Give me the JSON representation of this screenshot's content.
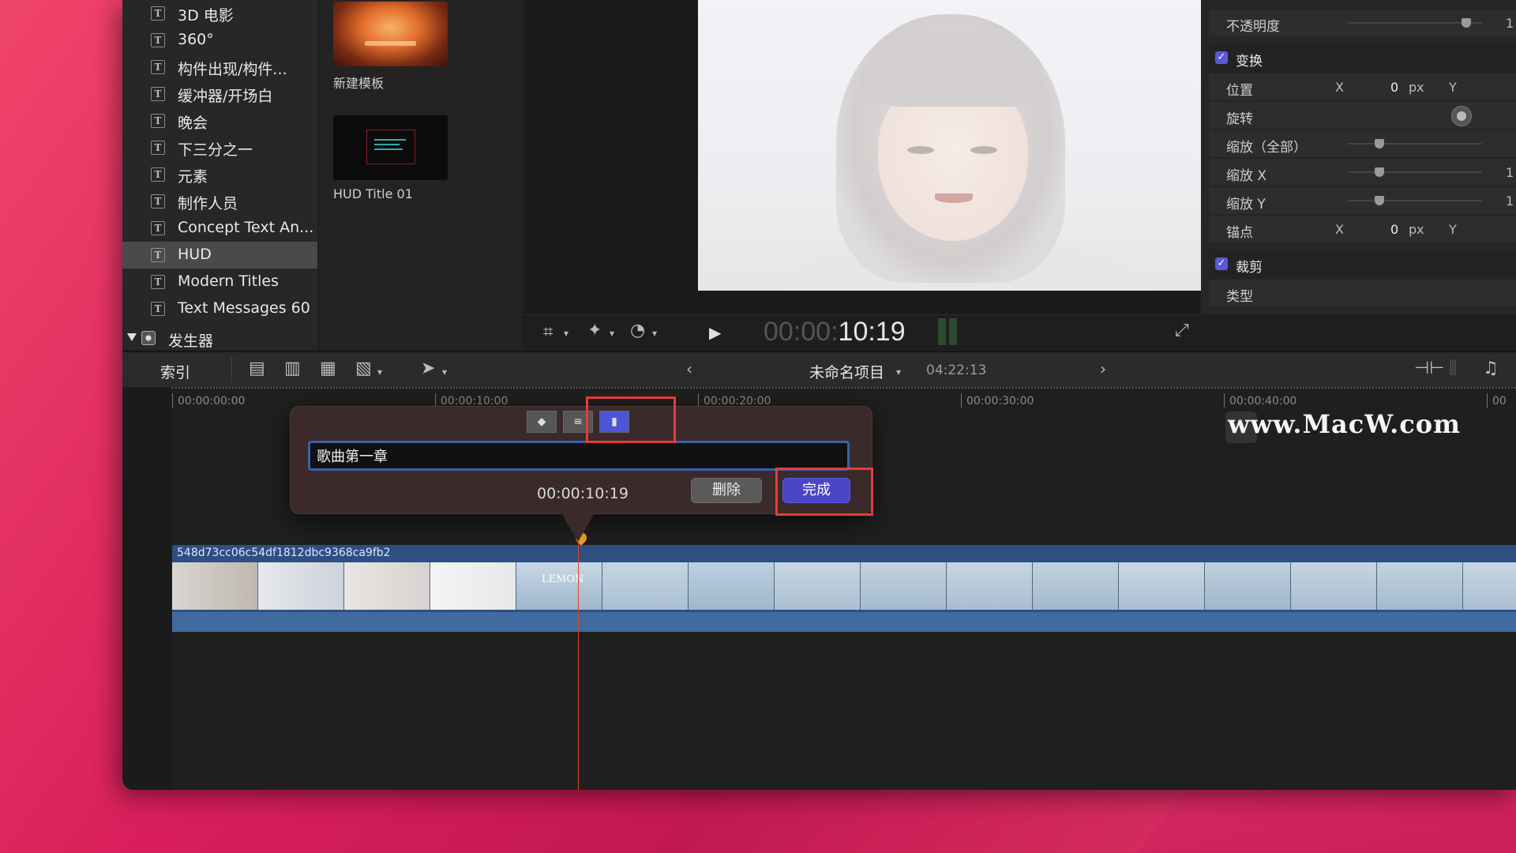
{
  "sidebar": {
    "items": [
      {
        "label": "3D 电影"
      },
      {
        "label": "360°"
      },
      {
        "label": "构件出现/构件..."
      },
      {
        "label": "缓冲器/开场白"
      },
      {
        "label": "晚会"
      },
      {
        "label": "下三分之一"
      },
      {
        "label": "元素"
      },
      {
        "label": "制作人员"
      },
      {
        "label": "Concept Text An..."
      },
      {
        "label": "HUD"
      },
      {
        "label": "Modern Titles"
      },
      {
        "label": "Text Messages 60"
      }
    ],
    "selected_index": 9,
    "group": {
      "label": "发生器"
    }
  },
  "browser": {
    "items": [
      {
        "label": "新建模板"
      },
      {
        "label": "HUD Title 01"
      }
    ]
  },
  "viewer": {
    "timecode_dim": "00:00:",
    "timecode_bright": "10:19"
  },
  "inspector": {
    "opacity": {
      "label": "不透明度",
      "value": "1"
    },
    "transform": {
      "label": "变换"
    },
    "position": {
      "label": "位置",
      "x_label": "X",
      "x_value": "0",
      "unit": "px",
      "y_label": "Y"
    },
    "rotation": {
      "label": "旋转"
    },
    "scale_all": {
      "label": "缩放（全部）"
    },
    "scale_x": {
      "label": "缩放 X",
      "value": "1"
    },
    "scale_y": {
      "label": "缩放 Y",
      "value": "1"
    },
    "anchor": {
      "label": "锚点",
      "x_label": "X",
      "x_value": "0",
      "unit": "px",
      "y_label": "Y"
    },
    "crop": {
      "label": "裁剪"
    },
    "type": {
      "label": "类型"
    }
  },
  "toolbar": {
    "index_label": "索引",
    "project_title": "未命名项目",
    "project_duration": "04:22:13"
  },
  "ruler": {
    "labels": [
      "00:00:00:00",
      "00:00:10:00",
      "00:00:20:00",
      "00:00:30:00",
      "00:00:40:00",
      "00"
    ]
  },
  "watermark": "www.MacW.com",
  "clip": {
    "name": "548d73cc06c54df1812dbc9368ca9fb2",
    "frame_text": "LEMON"
  },
  "marker_popover": {
    "name_value": "歌曲第一章",
    "time": "00:00:10:19",
    "delete_label": "删除",
    "done_label": "完成"
  },
  "colors": {
    "accent": "#4a46c8",
    "highlight": "#e83a3a",
    "clip": "#2e4f82",
    "playhead": "#e0482a",
    "marker": "#f0a020"
  }
}
